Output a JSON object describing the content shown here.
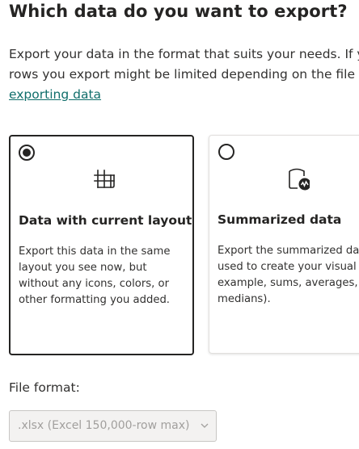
{
  "dialog": {
    "title": "Which data do you want to export?",
    "description_lines": [
      "Export your data in the format that suits your needs. If yo",
      "rows you export might be limited depending on the file"
    ],
    "learn_more_link": "exporting data"
  },
  "options": [
    {
      "title": "Data with current layout",
      "selected": true,
      "icon": "table-grid-icon",
      "description_lines": [
        "Export this data in the same",
        "layout you see now, but",
        "without any icons, colors, or",
        "other formatting you added."
      ]
    },
    {
      "title": "Summarized data",
      "selected": false,
      "icon": "summarized-data-icon",
      "description_lines": [
        "Export the summarized dat",
        "used to create your visual (",
        "example, sums, averages, a",
        "medians)."
      ]
    }
  ],
  "file_format": {
    "label": "File format:",
    "selected_value": ".xlsx (Excel 150,000-row max)",
    "disabled": true,
    "icon": "chevron-down-icon"
  },
  "colors": {
    "text": "#252423",
    "link": "#106e6b",
    "selected_border": "#252423",
    "unselected_border": "#e1dfdd",
    "disabled_bg": "#f3f2f1",
    "disabled_text": "#a19f9d"
  }
}
